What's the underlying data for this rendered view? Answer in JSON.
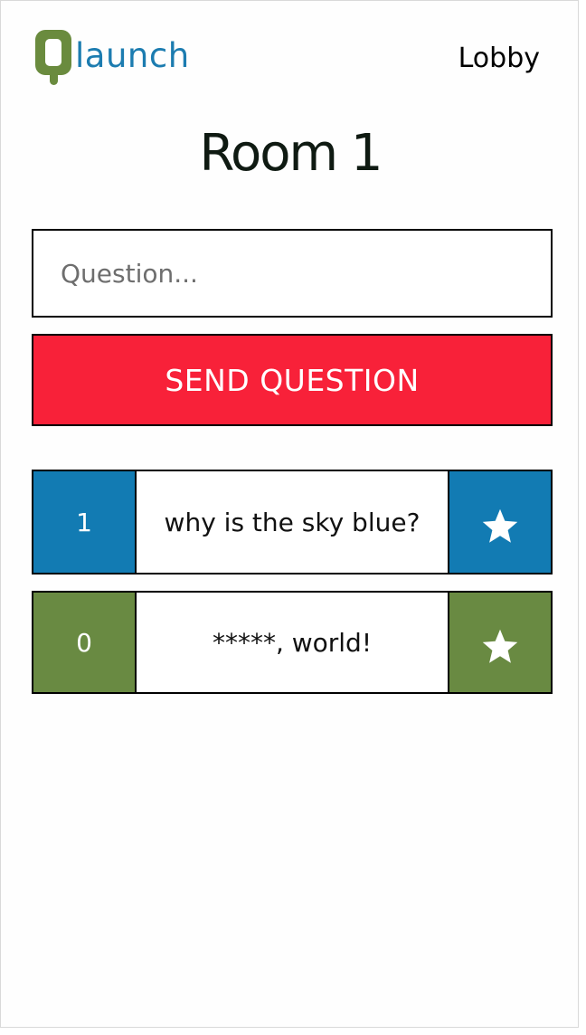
{
  "header": {
    "logo_text": "launch",
    "nav_lobby": "Lobby"
  },
  "room": {
    "title": "Room 1"
  },
  "form": {
    "question_placeholder": "Question...",
    "send_label": "SEND QUESTION"
  },
  "questions": [
    {
      "votes": "1",
      "text": "why is the sky blue?",
      "color": "#127bb3",
      "star": "star-icon"
    },
    {
      "votes": "0",
      "text": "*****, world!",
      "color": "#698a42",
      "star": "star-icon"
    }
  ],
  "colors": {
    "brand_green": "#6a8b3e",
    "brand_blue": "#1c7cb0",
    "send_red": "#f82139"
  }
}
